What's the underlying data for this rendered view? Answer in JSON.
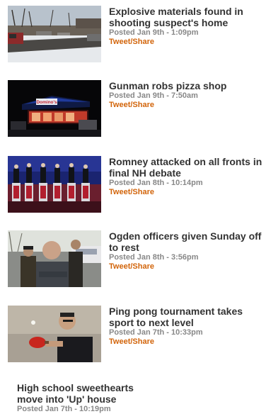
{
  "stories": [
    {
      "headline": "Explosive materials found in shooting suspect's home",
      "posted": "Posted Jan 9th - 1:09pm",
      "share": "Tweet/Share",
      "image": "snowy-street-photo"
    },
    {
      "headline": "Gunman robs pizza shop",
      "posted": "Posted Jan 9th - 7:50am",
      "share": "Tweet/Share",
      "image": "pizza-shop-night-photo",
      "sign_text": "Domino's"
    },
    {
      "headline": "Romney attacked on all fronts in final NH debate",
      "posted": "Posted Jan 8th - 10:14pm",
      "share": "Tweet/Share",
      "image": "debate-stage-photo"
    },
    {
      "headline": "Ogden officers given Sunday off to rest",
      "posted": "Posted Jan 8th - 3:56pm",
      "share": "Tweet/Share",
      "image": "officers-photo"
    },
    {
      "headline": "Ping pong tournament takes sport to next level",
      "posted": "Posted Jan 7th - 10:33pm",
      "share": "Tweet/Share",
      "image": "ping-pong-player-photo"
    },
    {
      "headline": "High school sweethearts move into 'Up' house",
      "posted": "Posted Jan 7th - 10:19pm"
    }
  ],
  "colors": {
    "headline": "#333333",
    "posted": "#888888",
    "share_link": "#d2640a"
  }
}
